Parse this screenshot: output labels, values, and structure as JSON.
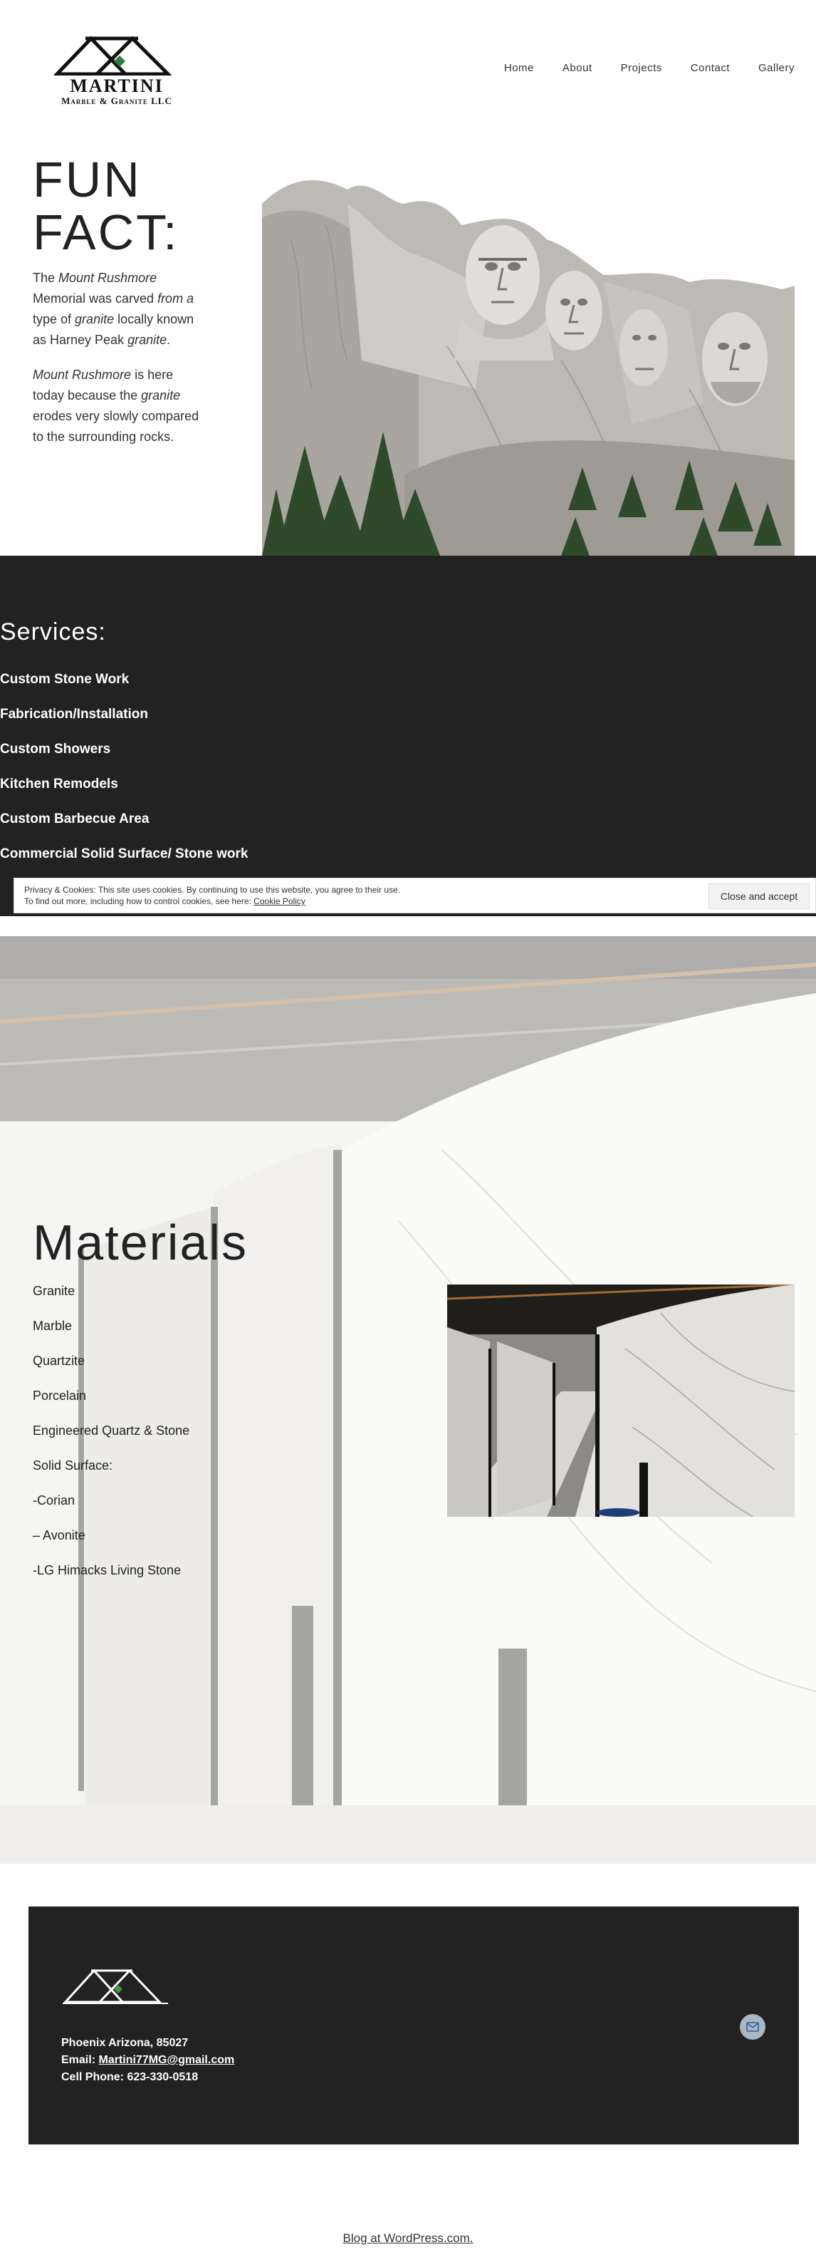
{
  "header": {
    "logo_name": "MARTINI",
    "logo_sub": "Marble & Granite LLC",
    "nav": [
      "Home",
      "About",
      "Projects",
      "Contact",
      "Gallery"
    ]
  },
  "fun_fact": {
    "title_line1": "FUN",
    "title_line2": "FACT:",
    "p1": {
      "a": "The ",
      "b": "Mount Rushmore",
      "c": " Memorial was carved ",
      "d": "from a",
      "e": " type of ",
      "f": "granite",
      "g": " locally known as Harney Peak ",
      "h": "granite",
      "i": "."
    },
    "p2": {
      "a": "Mount Rushmore",
      "b": " is here today because the ",
      "c": "granite",
      "d": " erodes very slowly compared to the surrounding rocks."
    }
  },
  "services": {
    "title": "Services:",
    "items": [
      "Custom Stone Work",
      "Fabrication/Installation",
      "Custom Showers",
      "Kitchen Remodels",
      "Custom Barbecue Area",
      "Commercial Solid Surface/ Stone work"
    ]
  },
  "cookie": {
    "line1": "Privacy & Cookies: This site uses cookies. By continuing to use this website, you agree to their use.",
    "line2": "To find out more, including how to control cookies, see here: ",
    "link": "Cookie Policy",
    "button": "Close and accept"
  },
  "materials": {
    "title": "Materials",
    "items": [
      "Granite",
      "Marble",
      "Quartzite",
      "Porcelain",
      "Engineered Quartz & Stone",
      "Solid Surface:",
      "-Corian",
      "– Avonite",
      "-LG Himacks Living Stone"
    ]
  },
  "footer": {
    "address": "Phoenix Arizona, 85027",
    "email_label": "Email: ",
    "email": "Martini77MG@gmail.com",
    "phone": "Cell Phone: 623-330-0518",
    "mail_icon": "envelope-icon"
  },
  "credit": "Blog at WordPress.com.",
  "colors": {
    "dark_band": "#222222",
    "text": "#222222",
    "mail_button": "#aab7c4"
  }
}
